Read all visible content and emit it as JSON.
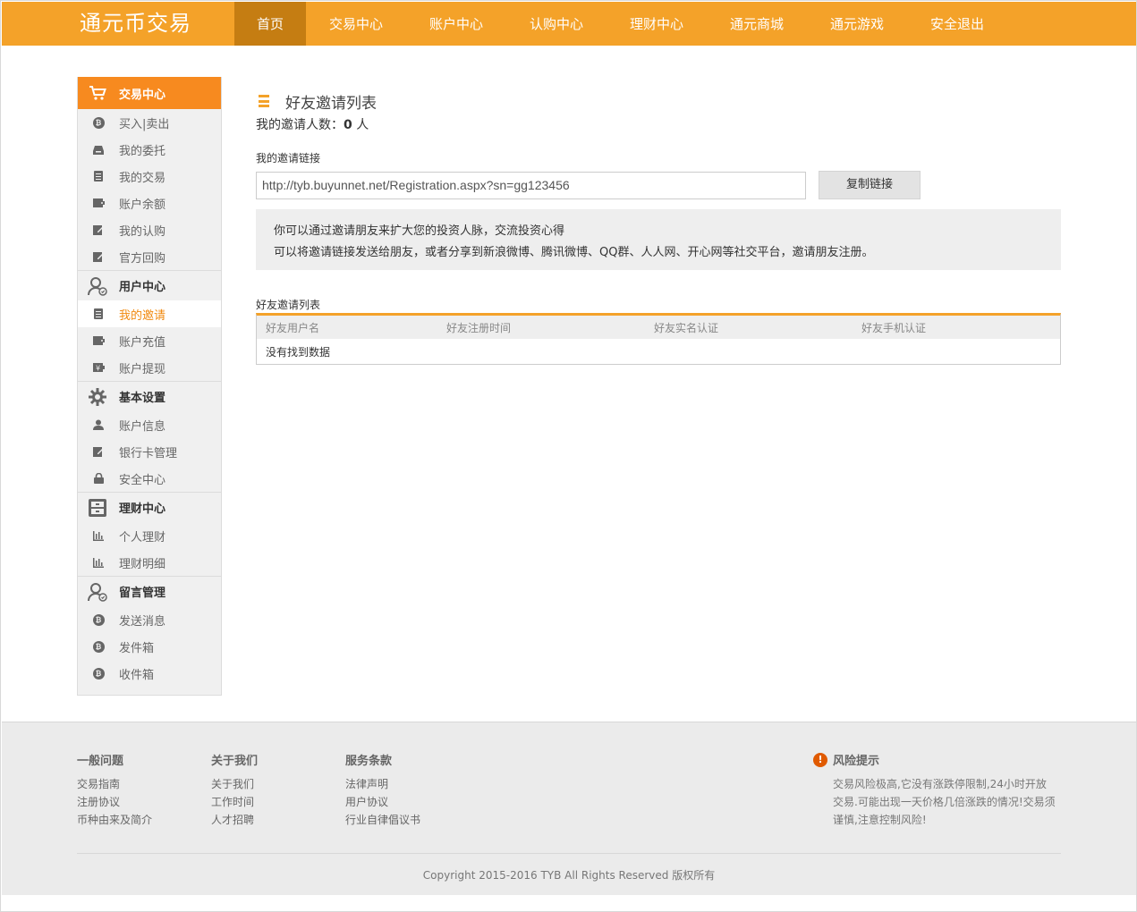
{
  "brand": "通元币交易",
  "nav": [
    "首页",
    "交易中心",
    "账户中心",
    "认购中心",
    "理财中心",
    "通元商城",
    "通元游戏",
    "安全退出"
  ],
  "sidebar": {
    "sections": [
      {
        "title": "交易中心",
        "icon": "cart-icon",
        "items": [
          {
            "label": "买入|卖出",
            "icon": "coin-icon"
          },
          {
            "label": "我的委托",
            "icon": "tray-icon"
          },
          {
            "label": "我的交易",
            "icon": "document-icon"
          },
          {
            "label": "账户余额",
            "icon": "wallet-icon"
          },
          {
            "label": "我的认购",
            "icon": "edit-icon"
          },
          {
            "label": "官方回购",
            "icon": "edit-icon"
          }
        ]
      },
      {
        "title": "用户中心",
        "icon": "user-settings-icon",
        "items": [
          {
            "label": "我的邀请",
            "icon": "document-icon"
          },
          {
            "label": "账户充值",
            "icon": "wallet-icon"
          },
          {
            "label": "账户提现",
            "icon": "yen-icon"
          }
        ]
      },
      {
        "title": "基本设置",
        "icon": "gear-icon",
        "items": [
          {
            "label": "账户信息",
            "icon": "person-icon"
          },
          {
            "label": "银行卡管理",
            "icon": "edit-icon"
          },
          {
            "label": "安全中心",
            "icon": "lock-icon"
          }
        ]
      },
      {
        "title": "理财中心",
        "icon": "safe-icon",
        "items": [
          {
            "label": "个人理财",
            "icon": "bar-chart-icon"
          },
          {
            "label": "理财明细",
            "icon": "bar-chart-icon"
          }
        ]
      },
      {
        "title": "留言管理",
        "icon": "user-settings-icon",
        "items": [
          {
            "label": "发送消息",
            "icon": "coin-icon"
          },
          {
            "label": "发件箱",
            "icon": "coin-icon"
          },
          {
            "label": "收件箱",
            "icon": "coin-icon"
          }
        ]
      }
    ]
  },
  "main": {
    "title": "好友邀请列表",
    "invite_count_prefix": "我的邀请人数：",
    "invite_count": "0",
    "invite_count_suffix": " 人",
    "link_label": "我的邀请链接",
    "link_value": "http://tyb.buyunnet.net/Registration.aspx?sn=gg123456",
    "copy_button": "复制链接",
    "tip_line1": "你可以通过邀请朋友来扩大您的投资人脉，交流投资心得",
    "tip_line2": "可以将邀请链接发送给朋友，或者分享到新浪微博、腾讯微博、QQ群、人人网、开心网等社交平台，邀请朋友注册。",
    "table_label": "好友邀请列表",
    "table_headers": [
      "好友用户名",
      "好友注册时间",
      "好友实名认证",
      "好友手机认证"
    ],
    "empty_text": "没有找到数据"
  },
  "footer": {
    "cols": [
      {
        "title": "一般问题",
        "links": [
          "交易指南",
          "注册协议",
          "币种由来及简介"
        ]
      },
      {
        "title": "关于我们",
        "links": [
          "关于我们",
          "工作时间",
          "人才招聘"
        ]
      },
      {
        "title": "服务条款",
        "links": [
          "法律声明",
          "用户协议",
          "行业自律倡议书"
        ]
      }
    ],
    "risk_title": "风险提示",
    "risk_text": "交易风险极高,它没有涨跌停限制,24小时开放交易.可能出现一天价格几倍涨跌的情况!交易须谨慎,注意控制风险!",
    "copyright": "Copyright 2015-2016 TYB All Rights Reserved 版权所有"
  }
}
